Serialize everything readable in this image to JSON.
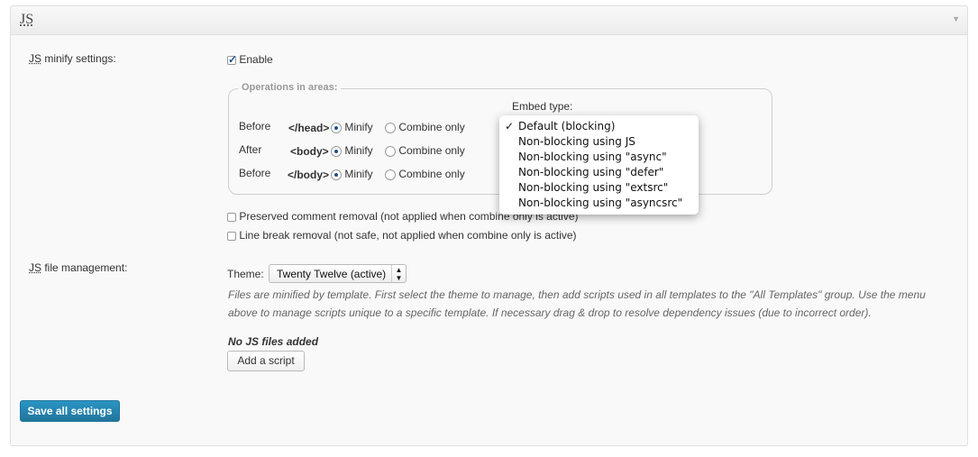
{
  "section": {
    "title": "JS"
  },
  "minify": {
    "label_abbr": "JS",
    "label_rest": " minify settings:",
    "enable_label": "Enable",
    "enable_checked": true
  },
  "operations": {
    "legend": "Operations in areas:",
    "embed_type_label": "Embed type:",
    "rows": [
      {
        "position": "Before",
        "tag": "</head>",
        "minify_label": "Minify",
        "combine_label": "Combine only"
      },
      {
        "position": "After",
        "tag": "<body>",
        "minify_label": "Minify",
        "combine_label": "Combine only"
      },
      {
        "position": "Before",
        "tag": "</body>",
        "minify_label": "Minify",
        "combine_label": "Combine only"
      }
    ],
    "embed_options": [
      "Default (blocking)",
      "Non-blocking using JS",
      "Non-blocking using \"async\"",
      "Non-blocking using \"defer\"",
      "Non-blocking using \"extsrc\"",
      "Non-blocking using \"asyncsrc\""
    ],
    "selected_check": "✓"
  },
  "options": {
    "comment_removal": "Preserved comment removal (not applied when combine only is active)",
    "line_break_removal": "Line break removal (not safe, not applied when combine only is active)"
  },
  "file_management": {
    "label_abbr": "JS",
    "label_rest": " file management:",
    "theme_label": "Theme:",
    "theme_value": "Twenty Twelve (active)",
    "description_line1": "Files are minified by template. First select the theme to manage, then add scripts used in all templates to the \"All Templates\" group. Use the menu",
    "description_line2": "above to manage scripts unique to a specific template. If necessary drag & drop to resolve dependency issues (due to incorrect order).",
    "no_files": "No JS files added",
    "add_script_label": "Add a script"
  },
  "footer": {
    "save_label": "Save all settings"
  }
}
